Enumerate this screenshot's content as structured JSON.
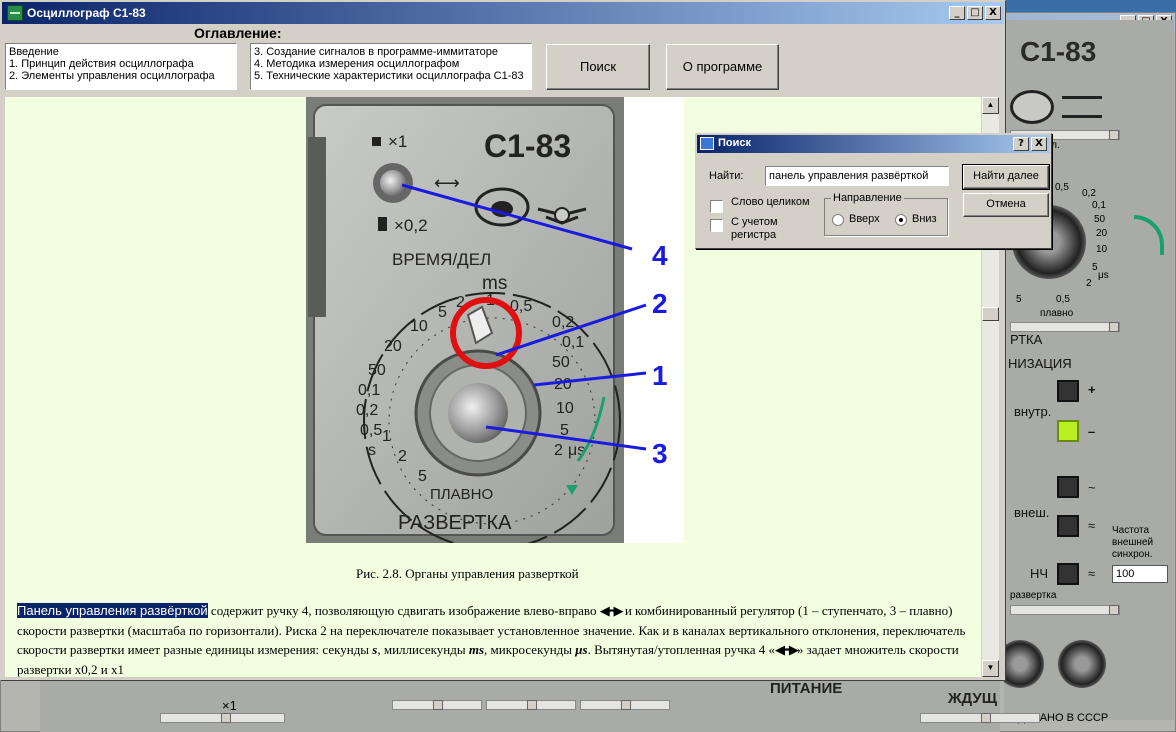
{
  "main_window": {
    "title": "Осциллограф С1-83",
    "title_buttons": [
      "_",
      "□",
      "X"
    ]
  },
  "toc": {
    "heading": "Оглавление:",
    "left_items": [
      "Введение",
      "1. Принцип действия осциллографа",
      "2. Элементы управления осциллографа"
    ],
    "right_items": [
      "3. Создание сигналов в программе-иммитаторе",
      "4. Методика измерения осциллографом",
      "5. Технические характеристики осциллографа С1-83"
    ]
  },
  "toolbar": {
    "search_label": "Поиск",
    "about_label": "О программе"
  },
  "figure": {
    "model": "С1-83",
    "multiplier_top": "×1",
    "multiplier_bottom": "×0,2",
    "time_div": "ВРЕМЯ/ДЕЛ",
    "ms": "ms",
    "smoothly": "ПЛАВНО",
    "sweep": "РАЗВЕРТКА",
    "s": "s",
    "mus": "μs",
    "scale_left": [
      "10",
      "20",
      "50",
      "0,1",
      "0,2",
      "0,5",
      "1",
      "2",
      "5"
    ],
    "scale_top": [
      "5",
      "2",
      "1",
      "0,5",
      "0,2",
      "0,1"
    ],
    "scale_right": [
      "50",
      "20",
      "10",
      "5",
      "2"
    ],
    "callouts": [
      "4",
      "2",
      "1",
      "3"
    ],
    "caption": "Рис. 2.8. Органы управления разверткой"
  },
  "paragraph": {
    "highlight": "Панель управления развёрткой",
    "part1": " содержит ручку 4, позволяющую сдвигать изображение влево-вправо ",
    "part2": " и комбинированный регулятор (1 – ступенчато, 3 – плавно) скорости развертки (масштаба по горизонтали). Риска 2 на переключателе показывает установленное значение. Как и в каналах вертикального отклонения, переключатель скорости развертки имеет разные единицы измерения: секунды ",
    "s": "s",
    "part3": ", миллисекунды ",
    "ms": "ms",
    "part4": ", микросекунды ",
    "mus": "μs",
    "part5": ". Вытянутая/утопленная ручка 4 «",
    "part6": "» задает множитель скорости развертки х0,2 и х1",
    "arrow": "◀━▶"
  },
  "search_dialog": {
    "title": "Поиск",
    "help_btn": "?",
    "close_btn": "X",
    "find_label": "Найти:",
    "find_value": "панель управления развёрткой",
    "find_next": "Найти далее",
    "cancel": "Отмена",
    "whole_word": "Слово целиком",
    "match_case_1": "С учетом",
    "match_case_2": "регистра",
    "direction_label": "Направление",
    "up": "Вверх",
    "down": "Вниз",
    "selected_direction": "down"
  },
  "background_panel": {
    "title_buttons": [
      "_",
      "□",
      "X"
    ],
    "model": "С1-83",
    "delen": "дел.",
    "dial_numbers": [
      "0,5",
      "0,2",
      "0,1",
      "50",
      "20",
      "10",
      "5",
      "2",
      "5",
      "0,5",
      "μs"
    ],
    "smoothly": "плавно",
    "sweep_part": "РТКА",
    "sync_part": "НИЗАЦИЯ",
    "internal": "внутр.",
    "external": "внеш.",
    "lf": "НЧ",
    "plus": "+",
    "minus": "–",
    "tilde": "~",
    "approx": "≈",
    "ext_freq": [
      "Частота",
      "внешней",
      "синхрон."
    ],
    "ext_freq_value": "100",
    "sweep_word": "развертка",
    "power": "ПИТАНИЕ",
    "standby": "ЖДУЩ",
    "made_in": "СДЕЛАНО В СССР",
    "x1": "×1"
  },
  "colors": {
    "content_bg": "#f1ffe0",
    "highlight_bg": "#0a246a",
    "titlebar": "#0a246a",
    "callout_blue": "#1a1ae0",
    "marker_red": "#e01010"
  }
}
